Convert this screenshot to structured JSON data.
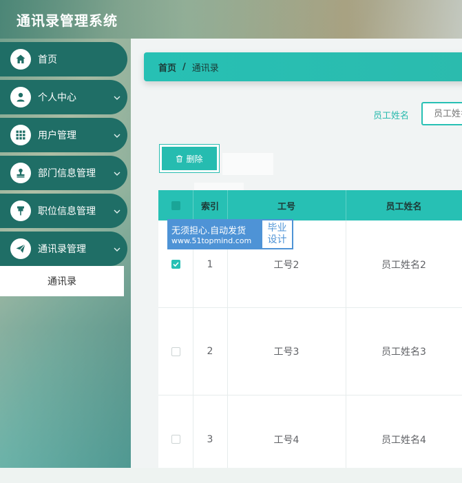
{
  "header": {
    "title": "通讯录管理系统"
  },
  "sidebar": {
    "items": [
      {
        "label": "首页",
        "icon": "home-icon",
        "has_chevron": false
      },
      {
        "label": "个人中心",
        "icon": "user-icon",
        "has_chevron": true
      },
      {
        "label": "用户管理",
        "icon": "grid-icon",
        "has_chevron": true
      },
      {
        "label": "部门信息管理",
        "icon": "stamp-icon",
        "has_chevron": true
      },
      {
        "label": "职位信息管理",
        "icon": "pin-icon",
        "has_chevron": true
      },
      {
        "label": "通讯录管理",
        "icon": "send-icon",
        "has_chevron": true
      }
    ],
    "submenu": {
      "label": "通讯录"
    }
  },
  "breadcrumb": {
    "home": "首页",
    "separator": "/",
    "current": "通讯录"
  },
  "search": {
    "label": "员工姓名",
    "placeholder": "员工姓名"
  },
  "toolbar": {
    "delete_label": "删除"
  },
  "table": {
    "columns": [
      "索引",
      "工号",
      "员工姓名"
    ],
    "rows": [
      {
        "checked": true,
        "index": "1",
        "id": "工号2",
        "name": "员工姓名2"
      },
      {
        "checked": false,
        "index": "2",
        "id": "工号3",
        "name": "员工姓名3"
      },
      {
        "checked": false,
        "index": "3",
        "id": "工号4",
        "name": "员工姓名4"
      }
    ]
  },
  "watermark": {
    "line1": "无须担心.自动发货",
    "line2": "www.51topmind.com",
    "tag1": "毕业",
    "tag2": "设计"
  },
  "colors": {
    "accent": "#27c0b4",
    "sidebar": "#1f6e66",
    "watermark": "#4e93d6"
  }
}
